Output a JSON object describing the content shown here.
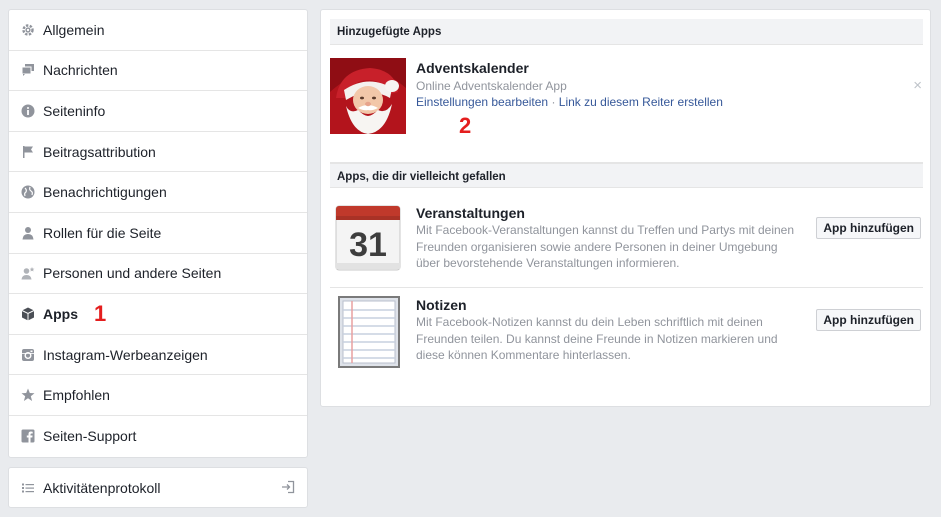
{
  "sidebar": {
    "items": [
      {
        "label": "Allgemein",
        "icon": "gear-icon"
      },
      {
        "label": "Nachrichten",
        "icon": "messages-icon"
      },
      {
        "label": "Seiteninfo",
        "icon": "info-icon"
      },
      {
        "label": "Beitragsattribution",
        "icon": "flag-icon"
      },
      {
        "label": "Benachrichtigungen",
        "icon": "globe-icon"
      },
      {
        "label": "Rollen für die Seite",
        "icon": "person-icon"
      },
      {
        "label": "Personen und andere Seiten",
        "icon": "person-star-icon"
      },
      {
        "label": "Apps",
        "icon": "cube-icon",
        "marker": "1"
      },
      {
        "label": "Instagram-Werbeanzeigen",
        "icon": "instagram-icon"
      },
      {
        "label": "Empfohlen",
        "icon": "star-icon"
      },
      {
        "label": "Seiten-Support",
        "icon": "facebook-icon"
      }
    ],
    "activity": {
      "label": "Aktivitätenprotokoll",
      "icon": "list-icon"
    }
  },
  "added_apps": {
    "heading": "Hinzugefügte Apps",
    "app": {
      "title": "Adventskalender",
      "subtitle": "Online Adventskalender App",
      "settings_link": "Einstellungen bearbeiten",
      "separator": "·",
      "tab_link": "Link zu diesem Reiter erstellen",
      "marker": "2",
      "close": "×"
    }
  },
  "suggested": {
    "heading": "Apps, die dir vielleicht gefallen",
    "apps": [
      {
        "title": "Veranstaltungen",
        "desc1": "Mit Facebook-Veranstaltungen kannst du Treffen und Partys mit deinen",
        "desc2": "Freunden organisieren sowie andere Personen in deiner Umgebung",
        "desc3": "über bevorstehende Veranstaltungen informieren.",
        "button": "App hinzufügen",
        "icon_text": "31"
      },
      {
        "title": "Notizen",
        "desc1": "Mit Facebook-Notizen kannst du dein Leben schriftlich mit deinen",
        "desc2": "Freunden teilen. Du kannst deine Freunde in Notizen markieren und",
        "desc3": "diese können Kommentare hinterlassen.",
        "button": "App hinzufügen"
      }
    ]
  },
  "colors": {
    "accent": "#365899",
    "marker": "#e41e1e"
  }
}
